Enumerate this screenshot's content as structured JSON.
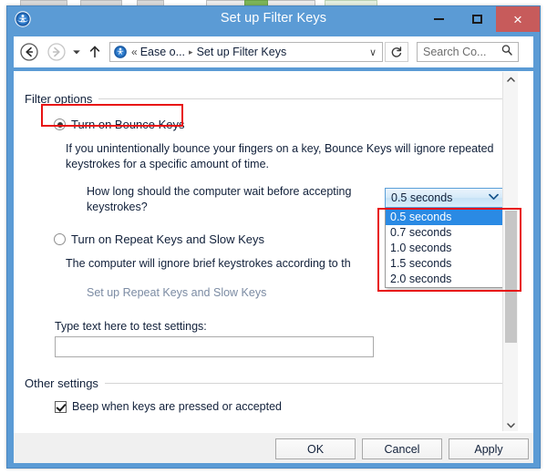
{
  "window": {
    "title": "Set up Filter Keys",
    "icon": "ease-of-access-icon",
    "minimize_label": "–",
    "maximize_label": "□",
    "close_label": "×",
    "close_color": "#c75b5b",
    "titlebar_color": "#5b9bd5"
  },
  "navbar": {
    "back_label": "←",
    "forward_label": "→",
    "history_label": "▾",
    "up_label": "↑",
    "address_icon": "ease-of-access-icon",
    "address_prefix": "«",
    "address_crumb_1": "Ease o...",
    "address_separator": "▸",
    "address_crumb_2": "Set up Filter Keys",
    "address_dropdown": "∨",
    "refresh_label": "⟳",
    "search_placeholder": "Search Co...",
    "search_value": ""
  },
  "filter_options": {
    "group_label": "Filter options",
    "bounce_keys": {
      "label": "Turn on Bounce Keys",
      "checked": true,
      "description": "If you unintentionally bounce your fingers on a key, Bounce Keys will ignore repeated keystrokes for a specific amount of time.",
      "wait_question": "How long should the computer wait before accepting keystrokes?"
    },
    "bounce_delay": {
      "selected": "0.5 seconds",
      "expanded": true,
      "options": [
        "0.5 seconds",
        "0.7 seconds",
        "1.0 seconds",
        "1.5 seconds",
        "2.0 seconds"
      ],
      "highlight_color": "#2a8ae4"
    },
    "repeat_slow_keys": {
      "label": "Turn on Repeat Keys and Slow Keys",
      "checked": false,
      "description": "The computer will ignore brief keystrokes according to th",
      "link_label": "Set up Repeat Keys and Slow Keys",
      "link_enabled": false
    },
    "test_field": {
      "label": "Type text here to test settings:",
      "value": "",
      "placeholder": ""
    }
  },
  "other_settings": {
    "group_label": "Other settings",
    "beep": {
      "label": "Beep when keys are pressed or accepted",
      "checked": true
    }
  },
  "annotations": {
    "color": "#e81313",
    "boxes": [
      "bounce-keys-radio-highlight",
      "dropdown-options-highlight"
    ]
  },
  "footer": {
    "ok_label": "OK",
    "cancel_label": "Cancel",
    "apply_label": "Apply"
  },
  "scrollbar": {
    "up_label": "⌃",
    "down_label": "⌄"
  }
}
